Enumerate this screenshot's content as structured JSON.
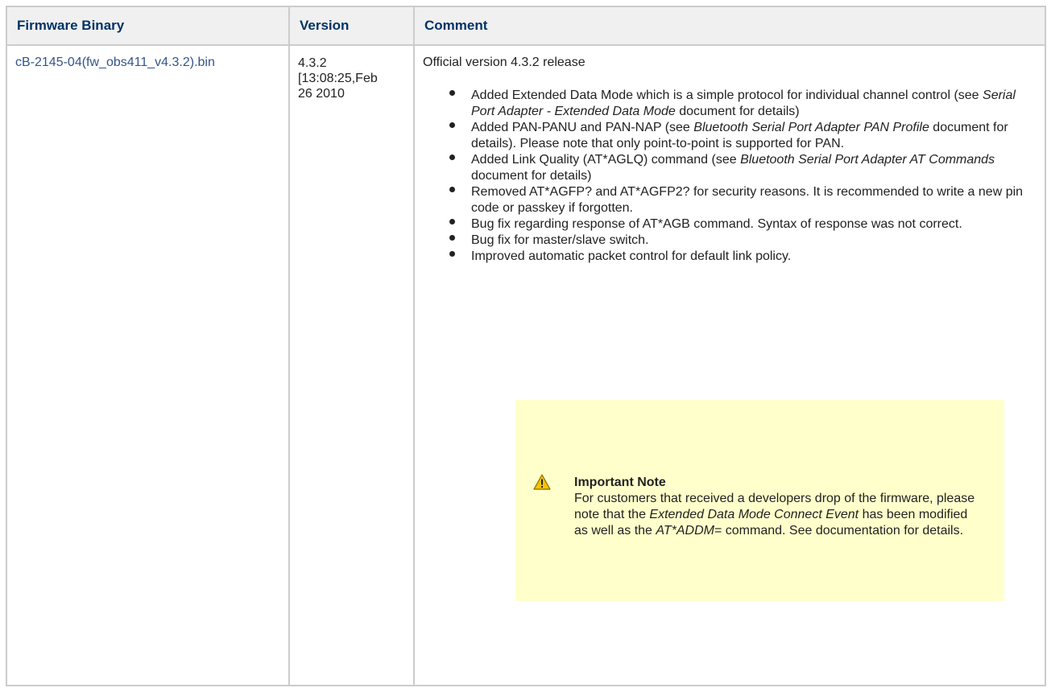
{
  "table": {
    "headers": {
      "binary": "Firmware Binary",
      "version": "Version",
      "comment": "Comment"
    },
    "row": {
      "binary_link": "cB-2145-04(fw_obs411_v4.3.2).bin",
      "version": [
        "4.3.2",
        "[13:08:25,Feb",
        "26 2010"
      ],
      "comment_intro": "Official version 4.3.2 release",
      "changes": [
        {
          "a": "Added Extended Data Mode which is a simple protocol for individual channel control (see ",
          "em": "Serial Port Adapter - Extended Data Mode",
          "b": " document for details)"
        },
        {
          "a": "Added PAN-PANU and PAN-NAP (see ",
          "em": "Bluetooth Serial Port Adapter PAN Profile",
          "b": " document for details). Please note that only point-to-point is supported for PAN."
        },
        {
          "a": "Added Link Quality (AT*AGLQ) command  (see ",
          "em": "Bluetooth Serial Port Adapter AT Commands",
          "b": " document for details)"
        },
        {
          "a": "Removed AT*AGFP? and AT*AGFP2? for security reasons. It is recommended to write a new pin code or passkey if forgotten.",
          "em": "",
          "b": ""
        },
        {
          "a": "Bug fix regarding response of AT*AGB command. Syntax of response was not correct.",
          "em": "",
          "b": ""
        },
        {
          "a": "Bug fix for master/slave switch.",
          "em": "",
          "b": ""
        },
        {
          "a": "Improved automatic packet control for default link policy.",
          "em": "",
          "b": ""
        }
      ]
    }
  },
  "note": {
    "icon": "warning-icon",
    "title": "Important Note",
    "text_a": "For customers that received a developers drop of the firmware, please note that the ",
    "em_a": "Extended Data Mode Connect Event",
    "text_b": " has been modified as well as the ",
    "em_b": "AT*ADDM",
    "text_c": "= command. See documentation for details."
  },
  "colors": {
    "header_text": "#003366",
    "header_bg": "#f0f0f0",
    "link": "#335588",
    "note_bg": "#ffffcc",
    "border": "#cccccc"
  }
}
